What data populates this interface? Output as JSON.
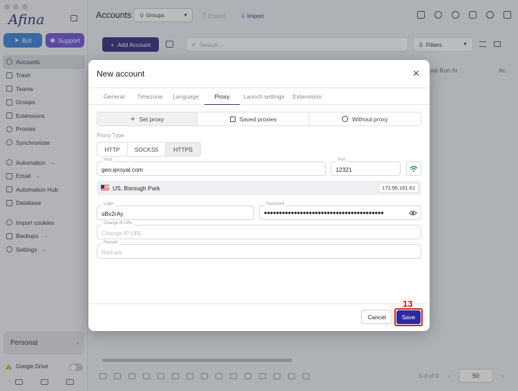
{
  "sidebar": {
    "logo": "Afina",
    "bot_label": "Bot",
    "support_label": "Support",
    "items": [
      {
        "label": "Accounts"
      },
      {
        "label": "Trash"
      },
      {
        "label": "Teams"
      },
      {
        "label": "Groups"
      },
      {
        "label": "Extensions"
      },
      {
        "label": "Proxies"
      },
      {
        "label": "Synchronizer"
      },
      {
        "label": "Automation"
      },
      {
        "label": "Email"
      },
      {
        "label": "Automation Hub"
      },
      {
        "label": "Database"
      },
      {
        "label": "Import cookies"
      },
      {
        "label": "Backups"
      },
      {
        "label": "Settings"
      }
    ],
    "workspace": "Personal",
    "google_drive": "Google Drive"
  },
  "toolbar": {
    "title": "Accounts",
    "groups_count": "0",
    "groups_label": "Groups",
    "export_label": "Export",
    "import_label": "Import",
    "add_account_label": "Add Account",
    "search_placeholder": "Search...",
    "filters_count": "0",
    "filters_label": "Filters"
  },
  "table": {
    "col_last_run": "Last Run At",
    "col_a": "Ac"
  },
  "pagination": {
    "range": "1–0 of 0",
    "per_page": "50"
  },
  "modal": {
    "title": "New account",
    "tabs": [
      "General",
      "Timezone",
      "Language",
      "Proxy",
      "Launch settings",
      "Extensions"
    ],
    "active_tab": "Proxy",
    "proxy_modes": [
      "Set proxy",
      "Saved proxies",
      "Without proxy"
    ],
    "proxy_type_label": "Proxy Type",
    "proxy_types": [
      "HTTP",
      "SOCKS5",
      "HTTPS"
    ],
    "active_proxy_type": "HTTPS",
    "host_label": "Host",
    "host_value": "geo.iproyal.com",
    "port_label": "Port",
    "port_value": "12321",
    "location": "US, Borough Park",
    "ip": "172.56.161.61",
    "login_label": "Login",
    "login_value": "sBv2rAy",
    "password_label": "Password",
    "password_value": "●●●●●●●●●●●●●●●●●●●●●●●●●●●●●●●●●●●●●●●●",
    "change_ip_label": "Change IP URL",
    "change_ip_placeholder": "Change IP URL",
    "remark_label": "Remark",
    "remark_placeholder": "Remark",
    "cancel_label": "Cancel",
    "save_label": "Save"
  },
  "annotation": {
    "step": "13",
    "color": "#d11a1a"
  },
  "colors": {
    "brand": "#2e2a78",
    "save": "#2e2a9e",
    "wifi": "#1e8e3e"
  }
}
